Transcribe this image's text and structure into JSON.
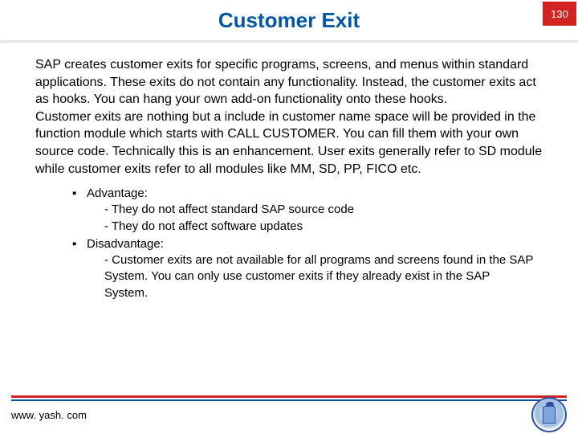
{
  "header": {
    "title": "Customer Exit",
    "page_number": "130"
  },
  "body": {
    "paragraph": "SAP creates customer exits for specific programs, screens, and menus within standard applications. These exits do not contain any functionality. Instead, the customer exits act as hooks. You can hang your own add-on functionality onto these hooks.\nCustomer exits are nothing but a include in customer name space will be provided in the function module which starts with CALL CUSTOMER. You can fill them with your own source code. Technically this is an enhancement. User exits generally refer to SD module while customer exits refer to all modules like MM, SD, PP, FICO etc."
  },
  "bullets": [
    {
      "heading": "Advantage:",
      "lines": [
        "- They do not affect standard SAP source code",
        "- They do not affect software updates"
      ]
    },
    {
      "heading": "Disadvantage:",
      "lines": [
        "- Customer exits are not available for all programs and screens found in the SAP System. You can only use customer exits if they already exist in the SAP System."
      ]
    }
  ],
  "footer": {
    "url": "www. yash. com"
  }
}
